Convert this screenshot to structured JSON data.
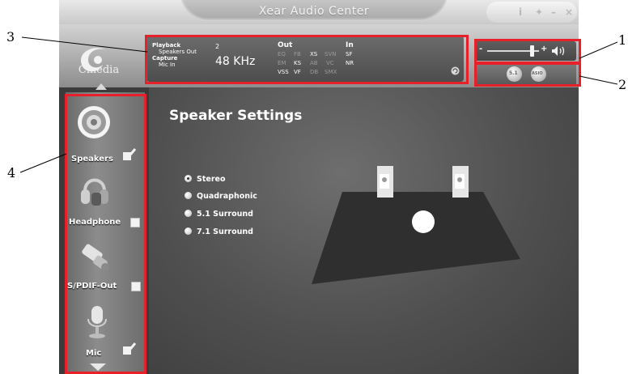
{
  "window": {
    "title": "Xear Audio Center"
  },
  "window_controls": {
    "info": "i",
    "settings": "✦",
    "minimize": "–",
    "close": "×"
  },
  "logo": {
    "text": "Cmedia"
  },
  "status_panel": {
    "playback_label": "Playback",
    "playback_device": "Speakers Out",
    "capture_label": "Capture",
    "capture_device": "Mic In",
    "channels": "2",
    "sample_rate": "48 KHz",
    "out_header": "Out",
    "in_header": "In",
    "out_row1": [
      "EQ",
      "FB",
      "XS",
      "SVN"
    ],
    "out_row2": [
      "EM",
      "KS",
      "AB",
      "VC"
    ],
    "out_row3": [
      "VSS",
      "VF",
      "DB",
      "SMX"
    ],
    "in_row1": "SF",
    "in_row2": "NR"
  },
  "volume": {
    "minus": "-",
    "plus": "+",
    "level": 0.85
  },
  "asio": {
    "button1": "5.1",
    "button2": "ASIO"
  },
  "sidebar": {
    "items": [
      {
        "label": "Speakers",
        "checked": true
      },
      {
        "label": "Headphone",
        "checked": false
      },
      {
        "label": "S/PDIF-Out",
        "checked": false
      },
      {
        "label": "Mic",
        "checked": true
      }
    ]
  },
  "main": {
    "heading": "Speaker Settings",
    "options": [
      "Stereo",
      "Quadraphonic",
      "5.1 Surround",
      "7.1 Surround"
    ],
    "selected": "Stereo"
  },
  "callouts": [
    "1",
    "2",
    "3",
    "4"
  ],
  "colors": {
    "annotation_red": "#e8202a",
    "panel_bg": "#3b3b3b"
  }
}
